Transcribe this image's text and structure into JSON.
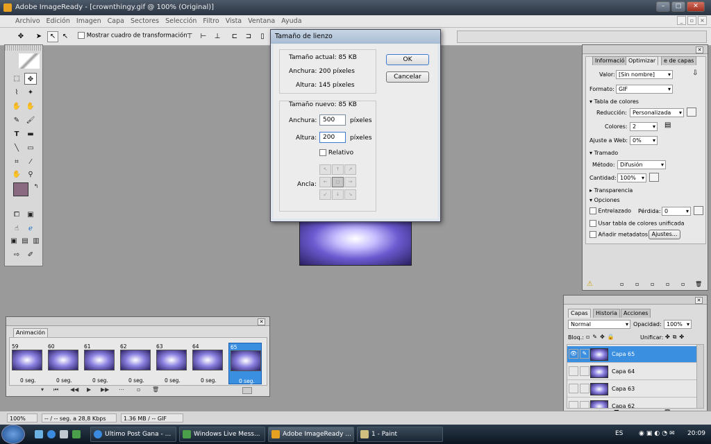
{
  "app": {
    "title": "Adobe ImageReady - [crownthingy.gif @ 100% (Original)]"
  },
  "menu": [
    "Archivo",
    "Edición",
    "Imagen",
    "Capa",
    "Sectores",
    "Selección",
    "Filtro",
    "Vista",
    "Ventana",
    "Ayuda"
  ],
  "options_bar": {
    "transform_label": "Mostrar cuadro de transformación"
  },
  "dialog": {
    "title": "Tamaño de lienzo",
    "current_size": "Tamaño actual: 85 KB",
    "current_width": "Anchura: 200 píxeles",
    "current_height": "Altura: 145 píxeles",
    "new_size": "Tamaño nuevo: 85 KB",
    "width_label": "Anchura:",
    "width_value": "500",
    "height_label": "Altura:",
    "height_value": "200",
    "unit": "píxeles",
    "relative_label": "Relativo",
    "anchor_label": "Ancla:",
    "ok_label": "OK",
    "cancel_label": "Cancelar"
  },
  "optimize_panel": {
    "tabs": [
      "Informació",
      "Optimizar",
      "e de capas"
    ],
    "valor_label": "Valor:",
    "valor_value": "[Sin nombre]",
    "formato_label": "Formato:",
    "formato_value": "GIF",
    "tabla_colores": "Tabla de colores",
    "reduccion_label": "Reducción:",
    "reduccion_value": "Personalizada",
    "colores_label": "Colores:",
    "colores_value": "2",
    "ajuste_label": "Ajuste a Web:",
    "ajuste_value": "0%",
    "tramado": "Tramado",
    "metodo_label": "Método:",
    "metodo_value": "Difusión",
    "cantidad_label": "Cantidad:",
    "cantidad_value": "100%",
    "transparencia": "Transparencia",
    "opciones": "Opciones",
    "entrelazado": "Entrelazado",
    "perdida_label": "Pérdida:",
    "perdida_value": "0",
    "usar_tabla": "Usar tabla de colores unificada",
    "anadir": "Añadir metadatos",
    "ajustes_btn": "Ajustes..."
  },
  "animation_panel": {
    "tab": "Animación",
    "frames": [
      {
        "num": "59",
        "delay": "0 seg."
      },
      {
        "num": "60",
        "delay": "0 seg."
      },
      {
        "num": "61",
        "delay": "0 seg."
      },
      {
        "num": "62",
        "delay": "0 seg."
      },
      {
        "num": "63",
        "delay": "0 seg."
      },
      {
        "num": "64",
        "delay": "0 seg."
      },
      {
        "num": "65",
        "delay": "0 seg."
      }
    ]
  },
  "layers_panel": {
    "tabs": [
      "Capas",
      "Historia",
      "Acciones"
    ],
    "blend_mode": "Normal",
    "opacity_label": "Opacidad:",
    "opacity_value": "100%",
    "lock_label": "Bloq.:",
    "unify_label": "Unificar:",
    "layers": [
      "Capa 65",
      "Capa 64",
      "Capa 63",
      "Capa 62"
    ]
  },
  "status": {
    "zoom": "100%",
    "speed": "-- / -- seg. a 28,8 Kbps",
    "size": "1.36 MB / -- GIF"
  },
  "taskbar": {
    "items": [
      "Ultimo Post Gana - ...",
      "Windows Live Mess...",
      "Adobe ImageReady ...",
      "1 - Paint"
    ],
    "lang": "ES",
    "time": "20:09"
  },
  "colors": {
    "foreground": "#8a6a80",
    "background": "#ffffff",
    "highlight": "#3b8fe0"
  }
}
